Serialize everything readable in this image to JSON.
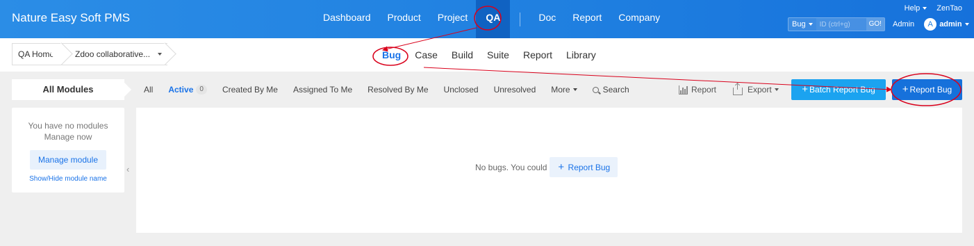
{
  "header": {
    "brand": "Nature Easy Soft PMS",
    "nav": [
      "Dashboard",
      "Product",
      "Project",
      "QA"
    ],
    "nav2": [
      "Doc",
      "Report",
      "Company"
    ],
    "help": "Help",
    "zentao": "ZenTao",
    "search_type": "Bug",
    "search_placeholder": "ID (ctrl+g)",
    "search_go": "GO!",
    "admin_label": "Admin",
    "avatar_letter": "A",
    "username": "admin"
  },
  "breadcrumb": {
    "home": "QA Home",
    "product": "Zdoo collaborative..."
  },
  "subnav": [
    "Bug",
    "Case",
    "Build",
    "Suite",
    "Report",
    "Library"
  ],
  "sidebar": {
    "title": "All Modules",
    "no_modules": "You have no modules",
    "manage_now": "Manage now",
    "manage_button": "Manage module",
    "show_hide": "Show/Hide module name"
  },
  "tabs": {
    "all": "All",
    "active": "Active",
    "active_count": "0",
    "created": "Created By Me",
    "assigned": "Assigned To Me",
    "resolved": "Resolved By Me",
    "unclosed": "Unclosed",
    "unresolved": "Unresolved",
    "more": "More",
    "search": "Search"
  },
  "actions": {
    "report": "Report",
    "export": "Export",
    "batch_report": "Batch Report Bug",
    "report_bug": "Report Bug"
  },
  "empty": {
    "message": "No bugs. You could",
    "button": "Report Bug"
  },
  "colors": {
    "header_blue": "#1f7fe0",
    "accent": "#1a73e8",
    "annotation_red": "#d9001b"
  }
}
